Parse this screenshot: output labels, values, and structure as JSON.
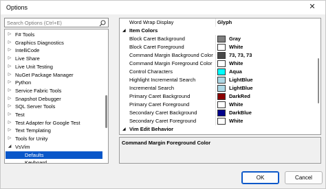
{
  "window": {
    "title": "Options",
    "close_glyph": "✕"
  },
  "search": {
    "placeholder": "Search Options (Ctrl+E)"
  },
  "tree": {
    "items": [
      {
        "label": "F# Tools",
        "expander": "▷"
      },
      {
        "label": "Graphics Diagnostics",
        "expander": "▷"
      },
      {
        "label": "IntelliCode",
        "expander": "▷"
      },
      {
        "label": "Live Share",
        "expander": "▷"
      },
      {
        "label": "Live Unit Testing",
        "expander": "▷"
      },
      {
        "label": "NuGet Package Manager",
        "expander": "▷"
      },
      {
        "label": "Python",
        "expander": "▷"
      },
      {
        "label": "Service Fabric Tools",
        "expander": "▷"
      },
      {
        "label": "Snapshot Debugger",
        "expander": "▷"
      },
      {
        "label": "SQL Server Tools",
        "expander": "▷"
      },
      {
        "label": "Test",
        "expander": "▷"
      },
      {
        "label": "Test Adapter for Google Test",
        "expander": "▷"
      },
      {
        "label": "Text Templating",
        "expander": "▷"
      },
      {
        "label": "Tools for Unity",
        "expander": "▷"
      },
      {
        "label": "VsVim",
        "expander": "◢"
      },
      {
        "label": "Defaults",
        "expander": ""
      },
      {
        "label": "Keyboard",
        "expander": ""
      }
    ]
  },
  "grid": {
    "rows": [
      {
        "type": "prop",
        "name": "Word Wrap Display",
        "value": "Glyph"
      },
      {
        "type": "category",
        "name": "Item Colors",
        "expander": "◢"
      },
      {
        "type": "color",
        "name": "Block Caret Background",
        "value": "Gray",
        "color": "#808080"
      },
      {
        "type": "color",
        "name": "Block Caret Foreground",
        "value": "White",
        "color": "#ffffff"
      },
      {
        "type": "color",
        "name": "Command Margin Background Color",
        "value": "73, 73, 73",
        "color": "#494949"
      },
      {
        "type": "color",
        "name": "Command Margin Foreground Color",
        "value": "White",
        "color": "#ffffff"
      },
      {
        "type": "color",
        "name": "Control Characters",
        "value": "Aqua",
        "color": "#00ffff"
      },
      {
        "type": "color",
        "name": "Highlight Incremental Search",
        "value": "LightBlue",
        "color": "#add8e6"
      },
      {
        "type": "color",
        "name": "Incremental Search",
        "value": "LightBlue",
        "color": "#add8e6"
      },
      {
        "type": "color",
        "name": "Primary Caret Background",
        "value": "DarkRed",
        "color": "#8b0000"
      },
      {
        "type": "color",
        "name": "Primary Caret Foreground",
        "value": "White",
        "color": "#ffffff"
      },
      {
        "type": "color",
        "name": "Secondary Caret Background",
        "value": "DarkBlue",
        "color": "#00008b"
      },
      {
        "type": "color",
        "name": "Secondary Caret Foreground",
        "value": "White",
        "color": "#ffffff"
      },
      {
        "type": "category",
        "name": "Vim Edit Behavior",
        "expander": "◢"
      }
    ]
  },
  "description": {
    "title": "Command Margin Foreground Color"
  },
  "buttons": {
    "ok": "OK",
    "cancel": "Cancel"
  }
}
